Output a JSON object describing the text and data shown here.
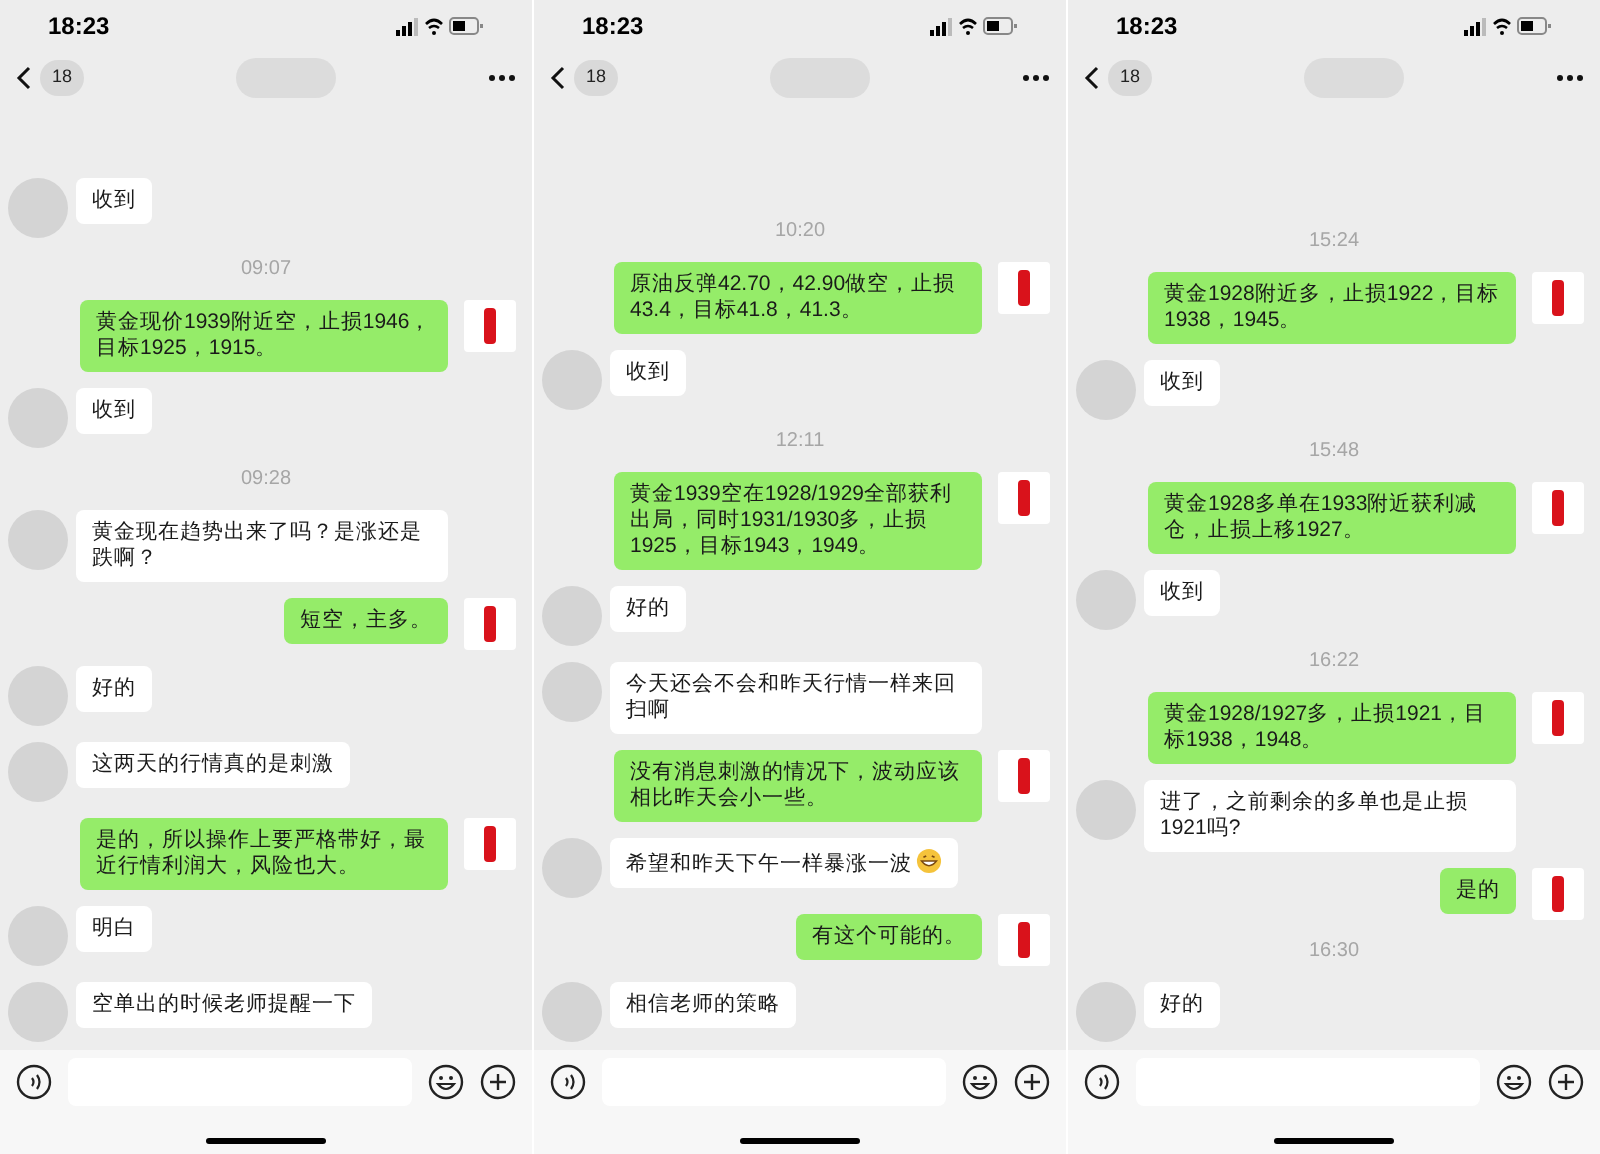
{
  "screens": [
    {
      "status_time": "18:23",
      "unread_count": "18",
      "messages": [
        {
          "kind": "in",
          "text": "收到"
        },
        {
          "kind": "time",
          "text": "09:07"
        },
        {
          "kind": "out",
          "text": "黄金现价1939附近空，止损1946，目标1925，1915。"
        },
        {
          "kind": "in",
          "text": "收到"
        },
        {
          "kind": "time",
          "text": "09:28"
        },
        {
          "kind": "in",
          "text": "黄金现在趋势出来了吗？是涨还是跌啊？"
        },
        {
          "kind": "out",
          "text": "短空，主多。"
        },
        {
          "kind": "in",
          "text": "好的"
        },
        {
          "kind": "in",
          "text": "这两天的行情真的是刺激"
        },
        {
          "kind": "out",
          "text": "是的，所以操作上要严格带好，最近行情利润大，风险也大。"
        },
        {
          "kind": "in",
          "text": "明白"
        },
        {
          "kind": "in",
          "text": "空单出的时候老师提醒一下"
        }
      ]
    },
    {
      "status_time": "18:23",
      "unread_count": "18",
      "messages": [
        {
          "kind": "time",
          "text": "10:20"
        },
        {
          "kind": "out",
          "text": "原油反弹42.70，42.90做空，止损43.4，目标41.8，41.3。"
        },
        {
          "kind": "in",
          "text": "收到"
        },
        {
          "kind": "time",
          "text": "12:11"
        },
        {
          "kind": "out",
          "text": "黄金1939空在1928/1929全部获利出局，同时1931/1930多，止损1925，目标1943，1949。"
        },
        {
          "kind": "in",
          "text": "好的"
        },
        {
          "kind": "in",
          "text": "今天还会不会和昨天行情一样来回扫啊"
        },
        {
          "kind": "out",
          "text": "没有消息刺激的情况下，波动应该相比昨天会小一些。"
        },
        {
          "kind": "in",
          "text": "希望和昨天下午一样暴涨一波",
          "emoji": true
        },
        {
          "kind": "out",
          "text": "有这个可能的。"
        },
        {
          "kind": "in",
          "text": "相信老师的策略"
        }
      ]
    },
    {
      "status_time": "18:23",
      "unread_count": "18",
      "messages": [
        {
          "kind": "time",
          "text": "15:24"
        },
        {
          "kind": "out",
          "text": "黄金1928附近多，止损1922，目标1938，1945。"
        },
        {
          "kind": "in",
          "text": "收到"
        },
        {
          "kind": "time",
          "text": "15:48"
        },
        {
          "kind": "out",
          "text": "黄金1928多单在1933附近获利减仓，止损上移1927。"
        },
        {
          "kind": "in",
          "text": "收到"
        },
        {
          "kind": "time",
          "text": "16:22"
        },
        {
          "kind": "out",
          "text": "黄金1928/1927多，止损1921，目标1938，1948。"
        },
        {
          "kind": "in",
          "text": "进了，之前剩余的多单也是止损1921吗?"
        },
        {
          "kind": "out",
          "text": "是的"
        },
        {
          "kind": "time",
          "text": "16:30"
        },
        {
          "kind": "in",
          "text": "好的"
        }
      ]
    }
  ]
}
